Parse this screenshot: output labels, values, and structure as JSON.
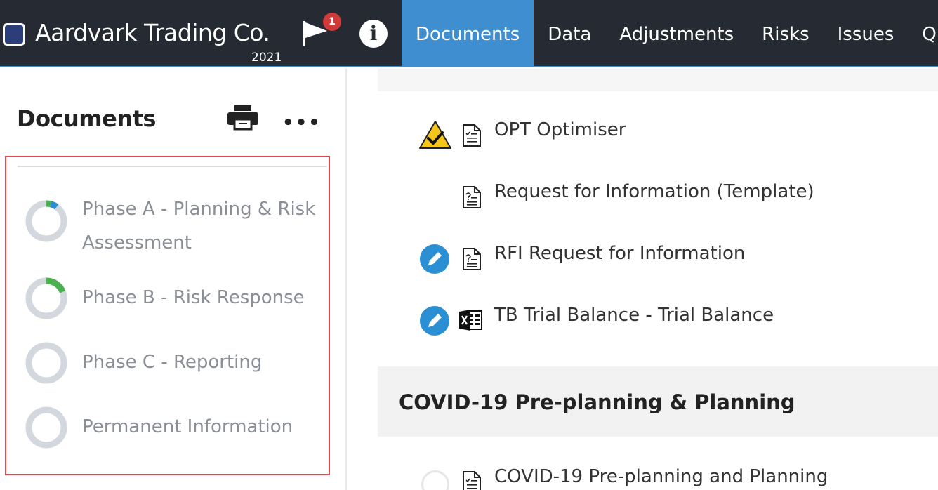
{
  "header": {
    "company": "Aardvark Trading Co.",
    "year": "2021",
    "flag_count": "1",
    "info_glyph": "i",
    "nav": [
      {
        "label": "Documents",
        "active": true
      },
      {
        "label": "Data"
      },
      {
        "label": "Adjustments"
      },
      {
        "label": "Risks"
      },
      {
        "label": "Issues"
      },
      {
        "label": "Que"
      }
    ],
    "colors": {
      "bar": "#252a33",
      "accent": "#3f8fd0",
      "badge": "#d23a3a"
    }
  },
  "sidebar": {
    "title": "Documents",
    "more_glyph": "•••",
    "phases": [
      {
        "label": "Phase A - Planning & Risk Assessment",
        "progress": {
          "green": 0.04,
          "blue": 0.06
        }
      },
      {
        "label": "Phase B - Risk Response",
        "progress": {
          "green": 0.19,
          "blue": 0
        }
      },
      {
        "label": "Phase C - Reporting",
        "progress": {
          "green": 0,
          "blue": 0
        }
      },
      {
        "label": "Permanent Information",
        "progress": {
          "green": 0,
          "blue": 0
        }
      }
    ]
  },
  "main": {
    "documents": [
      {
        "label": "OPT Optimiser",
        "status": "warning-check-icon",
        "type": "checklist-doc-icon"
      },
      {
        "label": "Request for Information (Template)",
        "status": "",
        "type": "question-doc-icon"
      },
      {
        "label": "RFI Request for Information",
        "status": "pencil-icon",
        "type": "question-doc-icon"
      },
      {
        "label": "TB Trial Balance - Trial Balance",
        "status": "pencil-icon",
        "type": "excel-icon"
      }
    ],
    "section": {
      "title": "COVID-19 Pre-planning & Planning",
      "documents": [
        {
          "label": "COVID-19 Pre-planning and Planning",
          "status": "empty-status-icon",
          "type": "checklist-doc-icon"
        }
      ]
    }
  }
}
